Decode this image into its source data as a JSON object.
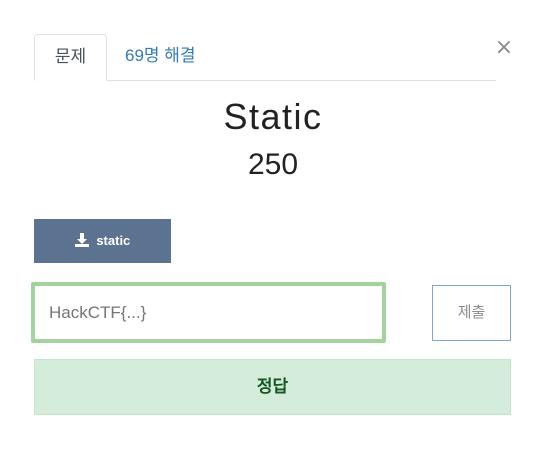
{
  "modal": {
    "close_glyph": "×"
  },
  "tabs": {
    "challenge": "문제",
    "solves": "69명 해결"
  },
  "challenge": {
    "name": "Static",
    "value": "250"
  },
  "file": {
    "label": "static",
    "icon": "download-icon"
  },
  "flag": {
    "placeholder": "HackCTF{...}",
    "value": ""
  },
  "submit": {
    "label": "제출"
  },
  "result": {
    "message": "정답"
  },
  "colors": {
    "file_button": "#5b7290",
    "input_border_success": "#a3d39c",
    "success_bg": "#d4edda",
    "success_text": "#155724",
    "link": "#337ab7"
  }
}
